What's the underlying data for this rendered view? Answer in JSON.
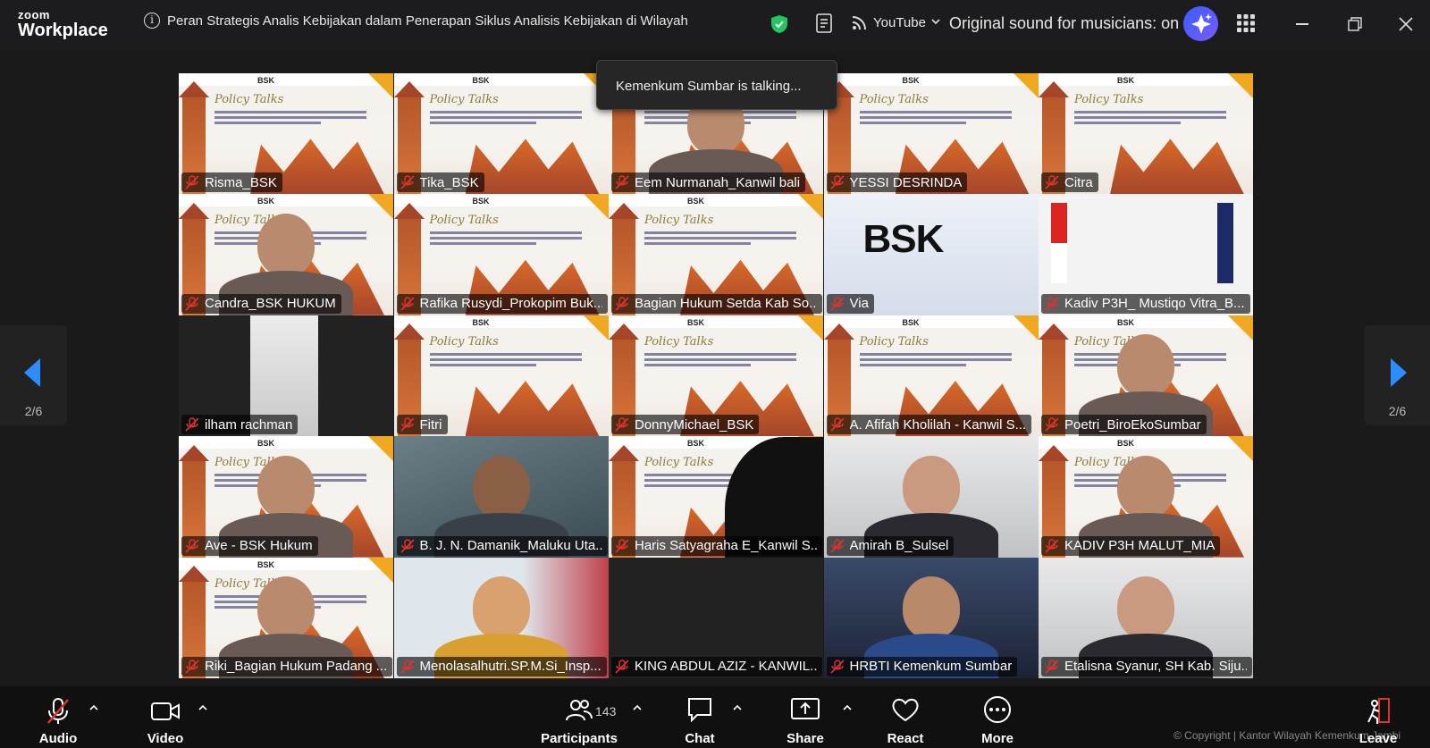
{
  "app": {
    "brand_top": "zoom",
    "brand_bottom": "Workplace"
  },
  "header": {
    "meeting_title": "Peran Strategis Analis Kebijakan dalam Penerapan Siklus Analisis Kebijakan di Wilayah",
    "stream_label": "YouTube",
    "sound_label": "Original sound for musicians: on"
  },
  "overlay": {
    "talking": "Kemenkum Sumbar is talking..."
  },
  "pagination": {
    "left": "2/6",
    "right": "2/6"
  },
  "participants": [
    {
      "name": "Risma_BSK",
      "kind": "slide"
    },
    {
      "name": "Tika_BSK",
      "kind": "slide"
    },
    {
      "name": "Eem Nurmanah_Kanwil bali",
      "kind": "slide-person"
    },
    {
      "name": "YESSI DESRINDA",
      "kind": "slide"
    },
    {
      "name": "Citra",
      "kind": "slide"
    },
    {
      "name": "Candra_BSK HUKUM",
      "kind": "slide-person"
    },
    {
      "name": "Rafika Rusydi_Prokopim Buk...",
      "kind": "slide"
    },
    {
      "name": "Bagian Hukum Setda Kab So...",
      "kind": "slide"
    },
    {
      "name": "Via",
      "kind": "bsk"
    },
    {
      "name": "Kadiv P3H_ Mustiqo Vitra_B...",
      "kind": "flags"
    },
    {
      "name": "ilham rachman",
      "kind": "portrait"
    },
    {
      "name": "Fitri",
      "kind": "slide"
    },
    {
      "name": "DonnyMichael_BSK",
      "kind": "slide"
    },
    {
      "name": "A. Afifah Kholilah - Kanwil S...",
      "kind": "slide"
    },
    {
      "name": "Poetri_BiroEkoSumbar",
      "kind": "slide-person"
    },
    {
      "name": "Ave - BSK Hukum",
      "kind": "slide-person"
    },
    {
      "name": "B. J. N. Damanik_Maluku Uta...",
      "kind": "video"
    },
    {
      "name": "Haris Satyagraha E_Kanwil S...",
      "kind": "slide-dark"
    },
    {
      "name": "Amirah B_Sulsel",
      "kind": "video-light"
    },
    {
      "name": "KADIV P3H MALUT_MIA",
      "kind": "slide-person"
    },
    {
      "name": "Riki_Bagian Hukum Padang ...",
      "kind": "slide-person"
    },
    {
      "name": "Menolasalhutri.SP.M.Si_Insp...",
      "kind": "video-red"
    },
    {
      "name": "KING ABDUL AZIZ - KANWIL...",
      "kind": "dark"
    },
    {
      "name": "HRBTI Kemenkum Sumbar",
      "kind": "video-blue"
    },
    {
      "name": "Etalisna Syanur, SH Kab. Siju...",
      "kind": "video-light"
    }
  ],
  "slide_text": {
    "bsk": "BSK",
    "bsk_big": "BSK",
    "cursive": "Policy Talks"
  },
  "toolbar": {
    "audio": "Audio",
    "video": "Video",
    "participants": "Participants",
    "participant_count": "143",
    "chat": "Chat",
    "share": "Share",
    "react": "React",
    "more": "More",
    "leave": "Leave"
  },
  "footer": {
    "copyright": "© Copyright | Kantor Wilayah Kemenkum Jambi"
  },
  "colors": {
    "accent_blue": "#2d8cff",
    "mute_red": "#e0332e",
    "shield_green": "#22c55e",
    "ai_purple": "#5a5cff"
  }
}
